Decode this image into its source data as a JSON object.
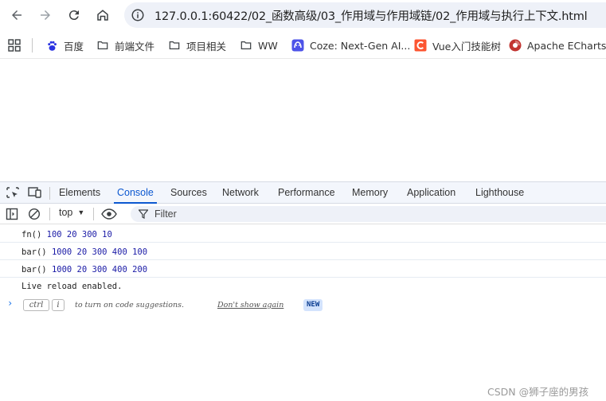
{
  "browser": {
    "url": "127.0.0.1:60422/02_函数高级/03_作用域与作用域链/02_作用域与执行上下文.html",
    "icons": {
      "back": "back-arrow-icon",
      "forward": "forward-arrow-icon",
      "reload": "reload-icon",
      "home": "home-icon",
      "info": "info-icon"
    }
  },
  "bookmarks": [
    {
      "label": "百度",
      "icon": "baidu-paw-icon",
      "color": "#2932e1"
    },
    {
      "label": "前端文件",
      "icon": "folder-icon"
    },
    {
      "label": "项目相关",
      "icon": "folder-icon"
    },
    {
      "label": "WW",
      "icon": "folder-icon"
    },
    {
      "label": "Coze: Next-Gen AI...",
      "icon": "coze-icon",
      "color": "#4d53e8"
    },
    {
      "label": "Vue入门技能树",
      "icon": "csdn-c-icon",
      "color": "#fc5531"
    },
    {
      "label": "Apache ECharts",
      "icon": "echarts-icon",
      "color": "#c23531"
    }
  ],
  "devtools": {
    "tabs": [
      {
        "label": "Elements",
        "active": false
      },
      {
        "label": "Console",
        "active": true
      },
      {
        "label": "Sources",
        "active": false
      },
      {
        "label": "Network",
        "active": false
      },
      {
        "label": "Performance",
        "active": false
      },
      {
        "label": "Memory",
        "active": false
      },
      {
        "label": "Application",
        "active": false
      },
      {
        "label": "Lighthouse",
        "active": false
      }
    ],
    "console_bar": {
      "context": "top",
      "filter_placeholder": "Filter"
    },
    "logs": [
      {
        "name": "fn()",
        "values": "100 20 300 10"
      },
      {
        "name": "bar()",
        "values": "1000 20 300 400 100"
      },
      {
        "name": "bar()",
        "values": "1000 20 300 400 200"
      },
      {
        "name": "Live reload enabled.",
        "values": ""
      }
    ],
    "prompt": {
      "key1": "ctrl",
      "key2": "i",
      "hint": "to turn on code suggestions.",
      "link": "Don't show again",
      "badge": "NEW"
    }
  },
  "watermark": "CSDN @狮子座的男孩",
  "colors": {
    "accent": "#0b57d0",
    "number": "#1a1aa6",
    "toolbar_bg": "#f3f6fc",
    "omnibox_bg": "#eef1f8"
  }
}
